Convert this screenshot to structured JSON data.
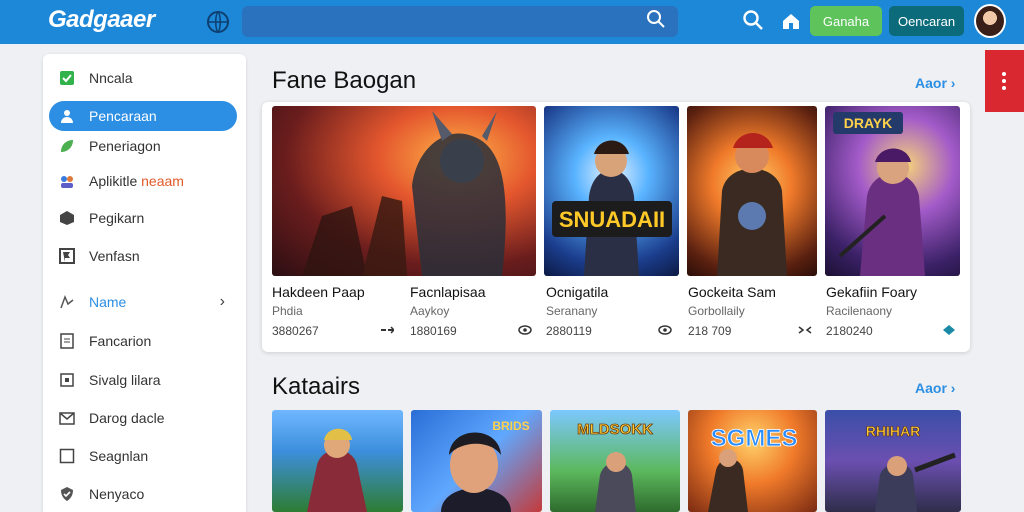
{
  "header": {
    "logo": "Gadgaaer",
    "search_placeholder": "",
    "btn_green": "Ganaha",
    "btn_teal": "Oencaran"
  },
  "sidebar": {
    "items": [
      {
        "label": "Nncala",
        "icon": "check-square-icon"
      },
      {
        "label": "Pencaraan",
        "icon": "user-icon"
      },
      {
        "label": "Peneriagon",
        "icon": "leaf-icon"
      },
      {
        "label": "Aplikitle",
        "label2": "neaam",
        "icon": "people-icon"
      },
      {
        "label": "Pegikarn",
        "icon": "cube-icon"
      },
      {
        "label": "Venfasn",
        "icon": "flag-icon"
      },
      {
        "label": "Name",
        "icon": "chart-icon"
      },
      {
        "label": "Fancarion",
        "icon": "doc-icon"
      },
      {
        "label": "Sivalg lilara",
        "icon": "square-icon"
      },
      {
        "label": "Darog dacle",
        "icon": "mail-icon"
      },
      {
        "label": "Seagnlan",
        "icon": "box-icon"
      },
      {
        "label": "Nenyaco",
        "icon": "shield-icon"
      }
    ]
  },
  "section1": {
    "title": "Fane Baogan",
    "more": "Aaor",
    "cards": [
      {
        "title": "Hakdeen Paap",
        "sub": "Phdia",
        "count": "3880267"
      },
      {
        "title": "Facnlapisaa",
        "sub": "Aaykoy",
        "count": "1880169"
      },
      {
        "title": "Ocnigatila",
        "sub": "Seranany",
        "count": "2880119"
      },
      {
        "title": "Gockeita Sam",
        "sub": "Gorbollaily",
        "count": "218 709"
      },
      {
        "title": "Gekafiin Foary",
        "sub": "Racilenaony",
        "count": "2180240"
      }
    ],
    "banner_text": "SNUADAII",
    "badge_text": "DRAYK"
  },
  "section2": {
    "title": "Kataairs",
    "more": "Aaor",
    "thumb_texts": [
      "",
      "BRIDS",
      "MLDSOKK",
      "SGMES",
      "RHIHAR"
    ]
  },
  "colors": {
    "topbar": "#1e88d8",
    "accent": "#2c8fe3",
    "green": "#5dc35a",
    "teal": "#0c6b7a",
    "red": "#d9282f"
  }
}
